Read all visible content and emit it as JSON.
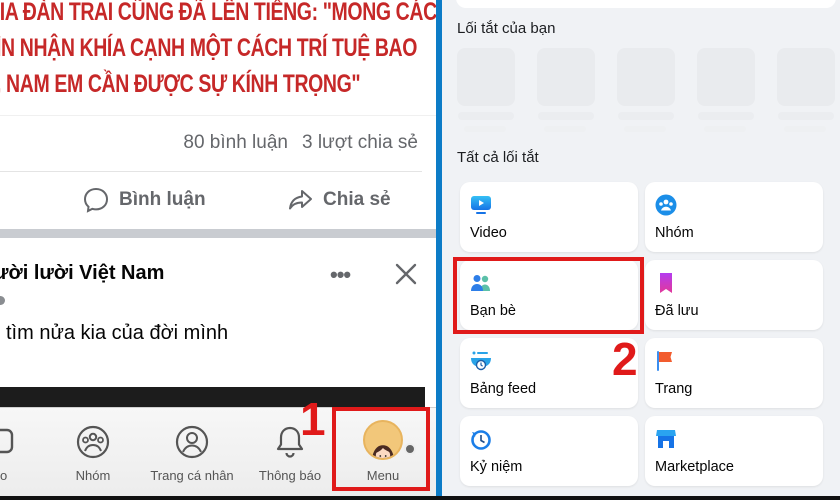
{
  "left_panel": {
    "headline_lines": [
      "HIA ĐÀN TRAI CŨNG ĐÃ LÊN TIẾNG: \"MONG CÁC",
      "ÌN NHẬN KHÍA CẠNH MỘT CÁCH TRÍ TUỆ BAO",
      ", NAM EM CẦN ĐƯỢC SỰ KÍNH TRỌNG\""
    ],
    "counts": {
      "comments": "80 bình luận",
      "shares": "3 lượt chia sẻ"
    },
    "actions": {
      "comment_label": "Bình luận",
      "share_label": "Chia sẻ"
    },
    "post2": {
      "author": "ười lười Việt Nam",
      "more": "•••",
      "text": "tìm nửa kia của đời mình"
    },
    "bottom_nav": [
      {
        "label": "eo",
        "icon": "video-icon"
      },
      {
        "label": "Nhóm",
        "icon": "groups-icon"
      },
      {
        "label": "Trang cá nhân",
        "icon": "profile-icon"
      },
      {
        "label": "Thông báo",
        "icon": "bell-icon"
      },
      {
        "label": "Menu",
        "icon": "avatar"
      }
    ],
    "annotation": "1"
  },
  "right_panel": {
    "section_shortcuts": "Lối tắt của bạn",
    "section_all": "Tất cả lối tắt",
    "tiles": [
      {
        "label": "Video",
        "icon": "video-tv-icon",
        "color": "#1b9be8"
      },
      {
        "label": "Nhóm",
        "icon": "groups-icon",
        "color": "#1877f2"
      },
      {
        "label": "Bạn bè",
        "icon": "friends-icon",
        "color": "#2d88ff"
      },
      {
        "label": "Đã lưu",
        "icon": "bookmark-icon",
        "color": "#a033ff"
      },
      {
        "label": "Bảng feed",
        "icon": "feed-icon",
        "color": "#29a3e8"
      },
      {
        "label": "Trang",
        "icon": "flag-icon",
        "color": "#f25c2e"
      },
      {
        "label": "Kỷ niệm",
        "icon": "memories-icon",
        "color": "#1877f2"
      },
      {
        "label": "Marketplace",
        "icon": "shop-icon",
        "color": "#1b8ee8"
      }
    ],
    "annotation": "2"
  },
  "colors": {
    "annotation_red": "#e01a1a",
    "divider_blue": "#0d7cc7",
    "headline_red": "#c62828"
  }
}
